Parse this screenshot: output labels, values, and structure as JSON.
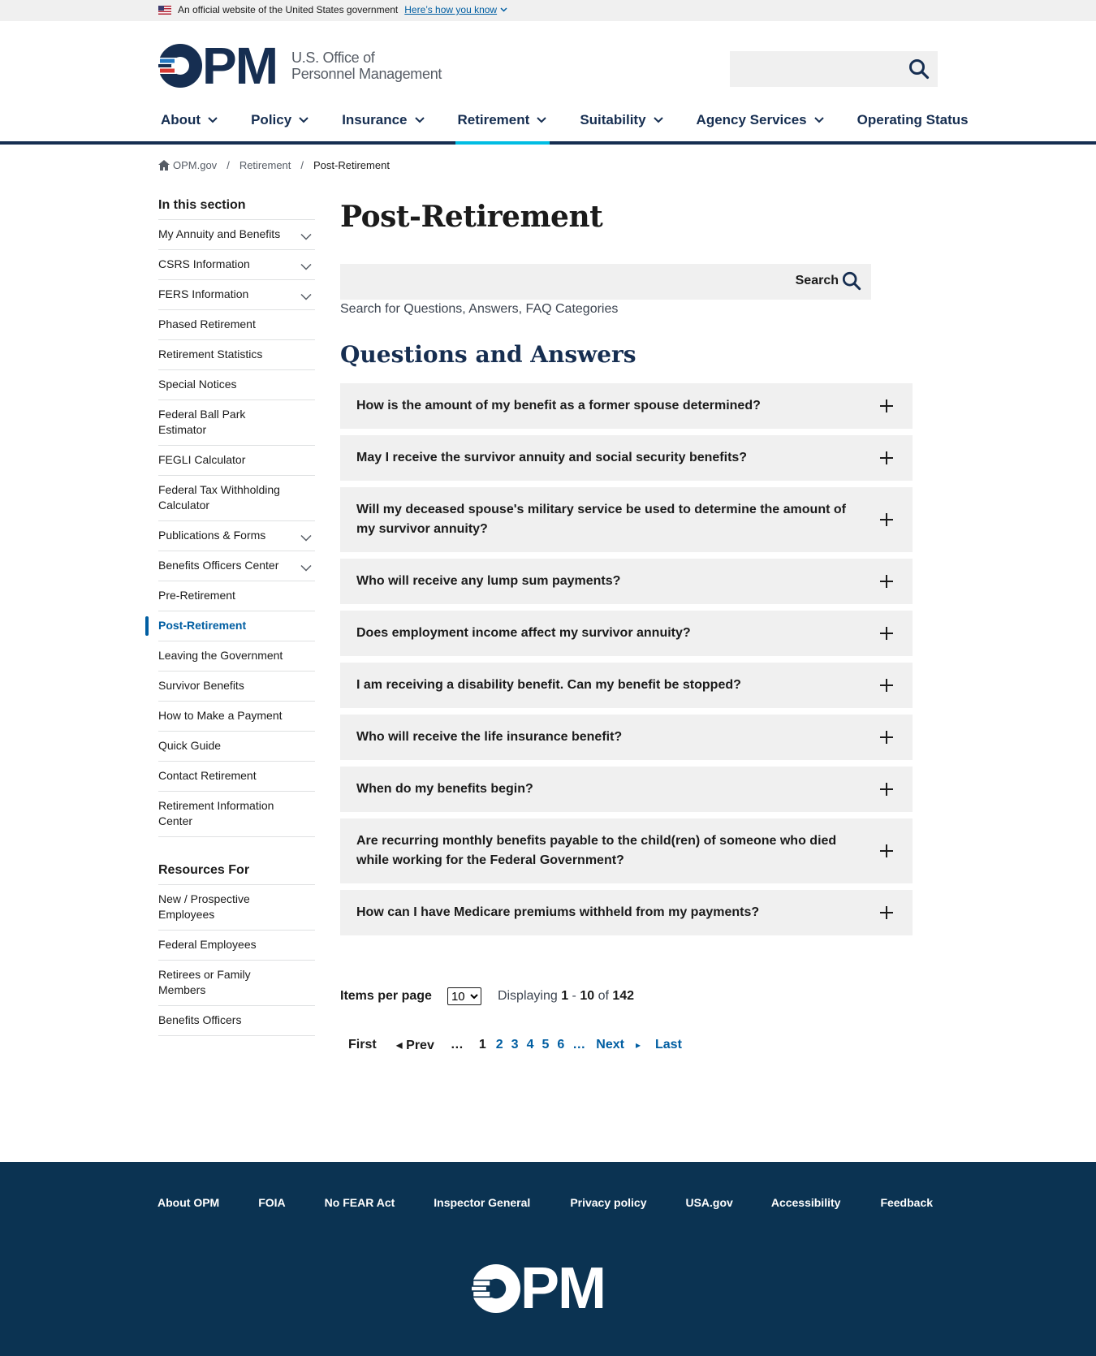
{
  "gov_banner": {
    "text": "An official website of the United States government",
    "link": "Here’s how you know"
  },
  "header": {
    "logo_letters": "PM",
    "logo_line1": "U.S. Office of",
    "logo_line2": "Personnel Management",
    "search_placeholder": ""
  },
  "nav": [
    {
      "label": "About",
      "has_menu": true
    },
    {
      "label": "Policy",
      "has_menu": true
    },
    {
      "label": "Insurance",
      "has_menu": true
    },
    {
      "label": "Retirement",
      "has_menu": true,
      "active": true
    },
    {
      "label": "Suitability",
      "has_menu": true
    },
    {
      "label": "Agency Services",
      "has_menu": true
    },
    {
      "label": "Operating Status",
      "has_menu": false
    }
  ],
  "breadcrumb": {
    "home": "OPM.gov",
    "level1": "Retirement",
    "current": "Post-Retirement"
  },
  "sidebar": {
    "heading": "In this section",
    "items": [
      {
        "label": "My Annuity and Benefits",
        "expandable": true
      },
      {
        "label": "CSRS Information",
        "expandable": true
      },
      {
        "label": "FERS Information",
        "expandable": true
      },
      {
        "label": "Phased Retirement"
      },
      {
        "label": "Retirement Statistics"
      },
      {
        "label": "Special Notices"
      },
      {
        "label": "Federal Ball Park Estimator"
      },
      {
        "label": "FEGLI Calculator"
      },
      {
        "label": "Federal Tax Withholding Calculator"
      },
      {
        "label": "Publications & Forms",
        "expandable": true
      },
      {
        "label": "Benefits Officers Center",
        "expandable": true
      },
      {
        "label": "Pre-Retirement"
      },
      {
        "label": "Post-Retirement",
        "current": true
      },
      {
        "label": "Leaving the Government"
      },
      {
        "label": "Survivor Benefits"
      },
      {
        "label": "How to Make a Payment"
      },
      {
        "label": "Quick Guide"
      },
      {
        "label": "Contact Retirement"
      },
      {
        "label": "Retirement Information Center"
      }
    ],
    "resources_heading": "Resources For",
    "resources": [
      {
        "label": "New / Prospective Employees"
      },
      {
        "label": "Federal Employees"
      },
      {
        "label": "Retirees or Family Members"
      },
      {
        "label": "Benefits Officers"
      }
    ]
  },
  "main": {
    "title": "Post-Retirement",
    "search_button": "Search",
    "search_hint": "Search for Questions, Answers, FAQ Categories",
    "qa_title": "Questions and Answers",
    "questions": [
      "How is the amount of my benefit as a former spouse determined?",
      "May I receive the survivor annuity and social security benefits?",
      "Will my deceased spouse's military service be used to determine the amount of my survivor annuity?",
      "Who will receive any lump sum payments?",
      "Does employment income affect my survivor annuity?",
      "I am receiving a disability benefit. Can my benefit be stopped?",
      "Who will receive the life insurance benefit?",
      "When do my benefits begin?",
      "Are recurring monthly benefits payable to the child(ren) of someone who died while working for the Federal Government?",
      "How can I have Medicare premiums withheld from my payments?"
    ]
  },
  "pager": {
    "items_per_page_label": "Items per page",
    "items_per_page_value": "10",
    "displaying_label": "Displaying",
    "range_start": "1",
    "range_sep": " - ",
    "range_end": "10",
    "of_label": "of",
    "total": "142",
    "first": "First",
    "prev": "◂ Prev",
    "ellipsis": "…",
    "current": "1",
    "pages": [
      "2",
      "3",
      "4",
      "5",
      "6"
    ],
    "next": "Next",
    "next_arrow": "▸",
    "last": "Last"
  },
  "footer": {
    "links": [
      "About OPM",
      "FOIA",
      "No FEAR Act",
      "Inspector General",
      "Privacy policy",
      "USA.gov",
      "Accessibility",
      "Feedback"
    ],
    "logo_letters": "PM"
  },
  "colors": {
    "navy": "#162e51",
    "footer_bg": "#0b3352",
    "link_blue": "#005ea2",
    "accent_cyan": "#00bde3",
    "logo_red": "#d83933",
    "logo_blue": "#2378c3"
  }
}
